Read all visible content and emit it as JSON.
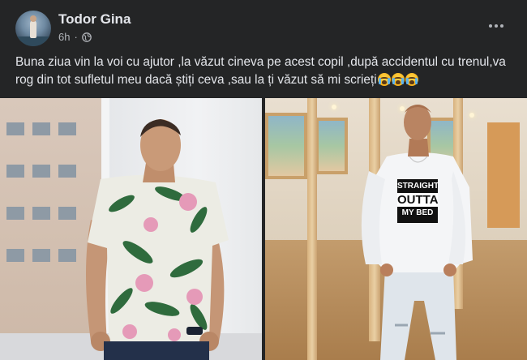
{
  "post": {
    "author": "Todor Gina",
    "time": "6h",
    "separator": "·",
    "visibility_icon": "globe-icon",
    "more_icon": "more-options-icon",
    "text": "Buna ziua vin la voi cu ajutor ,la văzut cineva pe acest copil ,după accidentul cu trenul,va rog din tot sufletul meu dacă știți ceva ,sau la ți văzut să mi scrieți",
    "emojis": [
      "crying-face-emoji",
      "crying-face-emoji",
      "crying-face-emoji"
    ]
  },
  "photo_right": {
    "shirt_lines": [
      "STRAIGHT",
      "OUTTA",
      "MY BED"
    ]
  },
  "colors": {
    "background": "#242526",
    "text_primary": "#e4e6eb",
    "text_secondary": "#b0b3b8"
  }
}
